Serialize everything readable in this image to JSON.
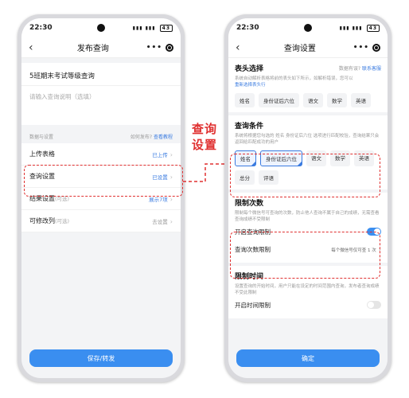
{
  "left_phone": {
    "status": {
      "time": "22:30",
      "battery": "43"
    },
    "nav": {
      "title": "发布查询",
      "back": "‹",
      "more": "•••"
    },
    "title_value": "5班期末考试等级查询",
    "desc_placeholder": "请输入查询说明（选填）",
    "section": {
      "label": "数据与设置",
      "help_prefix": "如何发布?",
      "help_link": "查看教程"
    },
    "rows": [
      {
        "label": "上传表格",
        "suffix": "",
        "value": "已上传"
      },
      {
        "label": "查询设置",
        "suffix": "",
        "value": "已设置"
      },
      {
        "label": "结果设置",
        "suffix": "(可选)",
        "value": "展示7项"
      },
      {
        "label": "可修改列",
        "suffix": "(可选)",
        "value": "去设置"
      }
    ],
    "save_label": "保存/转发"
  },
  "annotation": {
    "line1": "查询",
    "line2": "设置",
    "color": "#e03131"
  },
  "right_phone": {
    "status": {
      "time": "22:30",
      "battery": "43"
    },
    "nav": {
      "title": "查询设置",
      "back": "‹",
      "more": "•••"
    },
    "header_select": {
      "title": "表头选择",
      "aside_prefix": "数据有误?",
      "aside_link": "联系客服",
      "note": "系统自动解析表格将前的表头如下所示，如解析错误，您可以",
      "note_link": "重新选择表头行",
      "chips": [
        "姓名",
        "身份证后六位",
        "语文",
        "数学",
        "英语"
      ]
    },
    "query_conditions": {
      "title": "查询条件",
      "note": "系统将根据您勾选的 姓名 身份证后六位 选项进行匹配校验，查询结果只会返回给匹配成功的用户",
      "chips": [
        {
          "label": "姓名",
          "selected": true
        },
        {
          "label": "身份证后六位",
          "selected": true
        },
        {
          "label": "语文",
          "selected": false
        },
        {
          "label": "数学",
          "selected": false
        },
        {
          "label": "英语",
          "selected": false
        },
        {
          "label": "总分",
          "selected": false
        },
        {
          "label": "评语",
          "selected": false
        }
      ]
    },
    "limit_count": {
      "title": "限制次数",
      "note": "限制每个微信号可查询的次数，防止他人查询不属于自己的成绩，无需查看查询成绩不受限制",
      "toggle_label": "开启查询限制",
      "toggle_on": true,
      "count_label": "查询次数限制",
      "count_value": "每个微信号仅可查 1 次"
    },
    "limit_time": {
      "title": "限制时间",
      "note": "设置查询的开始时间，用户只能在设定的时间范围内查询，发布者查询成绩不受此限制",
      "toggle_label": "开启时间限制",
      "toggle_on": false
    },
    "confirm_label": "确定"
  }
}
